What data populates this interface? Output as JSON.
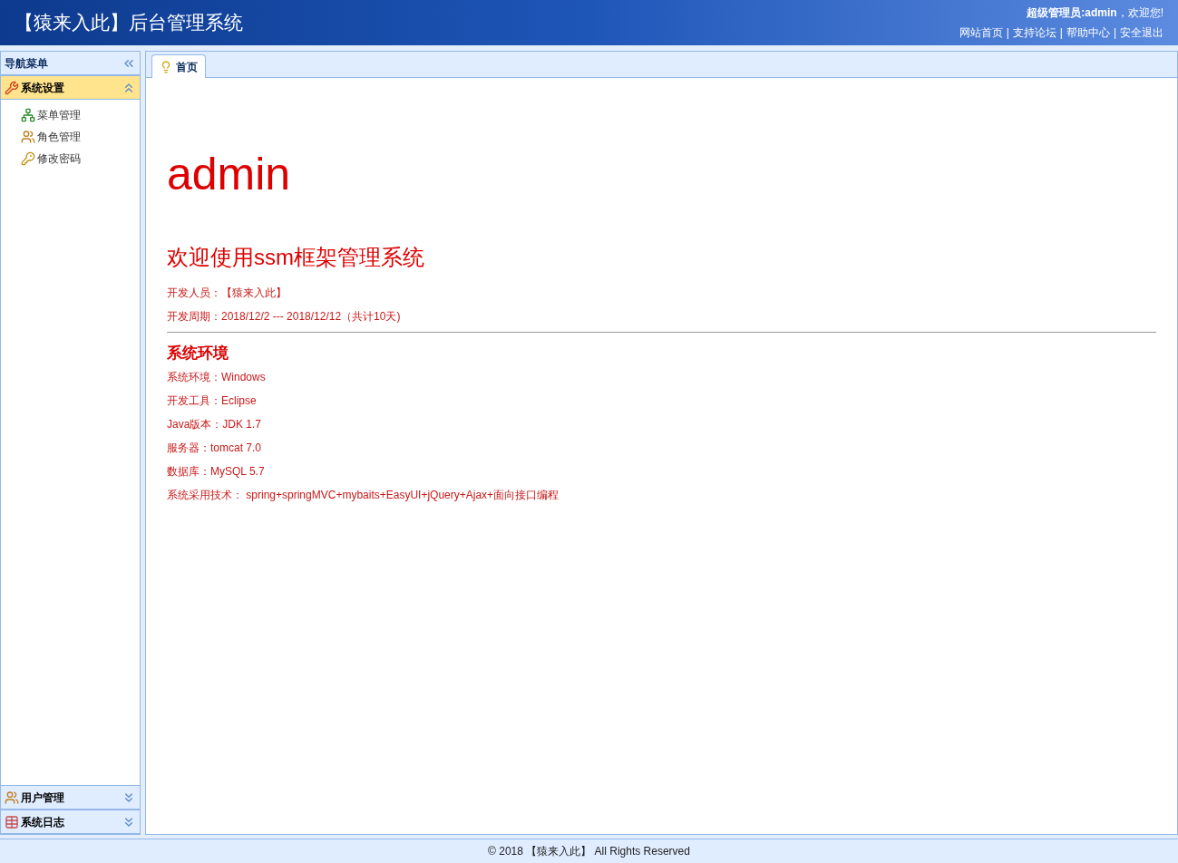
{
  "header": {
    "title": "【猿来入此】后台管理系统",
    "greeting": "**超级管理员:admin**，欢迎您!",
    "separator": "|",
    "links": [
      "网站首页",
      "支持论坛",
      "帮助中心",
      "安全退出"
    ]
  },
  "sidebar": {
    "title": "导航菜单",
    "panels": [
      {
        "title": "系统设置",
        "kind": "tools",
        "expanded": true,
        "items": [
          {
            "label": "菜单管理",
            "kind": "tree"
          },
          {
            "label": "角色管理",
            "kind": "users"
          },
          {
            "label": "修改密码",
            "kind": "key"
          }
        ]
      },
      {
        "title": "用户管理",
        "kind": "users",
        "expanded": false
      },
      {
        "title": "系统日志",
        "kind": "table",
        "expanded": false
      }
    ]
  },
  "tabs": [
    {
      "label": "首页",
      "selected": true
    }
  ],
  "content": {
    "heading": "admin",
    "subtitle": "欢迎使用ssm框架管理系统",
    "dev_info": [
      "开发人员：【猿来入此】",
      "开发周期：2018/12/2 --- 2018/12/12（共计10天)"
    ],
    "section_title": "系统环境",
    "env": [
      "系统环境：Windows",
      "开发工具：Eclipse",
      "Java版本：JDK 1.7",
      "服务器：tomcat 7.0",
      "数据库：MySQL 5.7",
      "系统采用技术： spring+springMVC+mybaits+EasyUI+jQuery+Ajax+面向接口编程"
    ]
  },
  "footer": "© 2018 【猿来入此】 All Rights Reserved"
}
